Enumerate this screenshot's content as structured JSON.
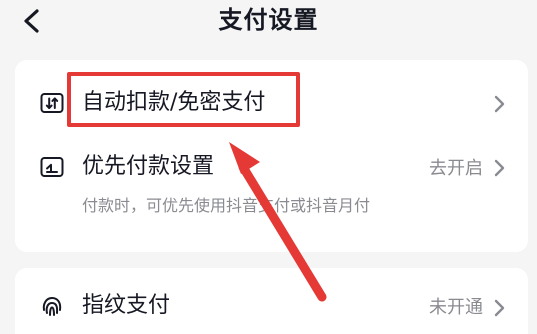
{
  "header": {
    "title": "支付设置",
    "back_icon": "chevron-left-icon"
  },
  "settings": {
    "auto_deduct": {
      "icon": "auto-deduct-icon",
      "label": "自动扣款/免密支付",
      "arrow_icon": "chevron-right-icon"
    },
    "priority_payment": {
      "icon": "priority-payment-icon",
      "label": "优先付款设置",
      "value": "去开启",
      "description": "付款时，可优先使用抖音支付或抖音月付",
      "arrow_icon": "chevron-right-icon"
    },
    "fingerprint_payment": {
      "icon": "fingerprint-icon",
      "label": "指纹支付",
      "value": "未开通",
      "arrow_icon": "chevron-right-icon"
    }
  },
  "annotation": {
    "color": "#e53935"
  },
  "colors": {
    "background": "#f5f5f5",
    "card": "#ffffff",
    "text": "#161823",
    "secondary_text": "#8a8b91"
  }
}
